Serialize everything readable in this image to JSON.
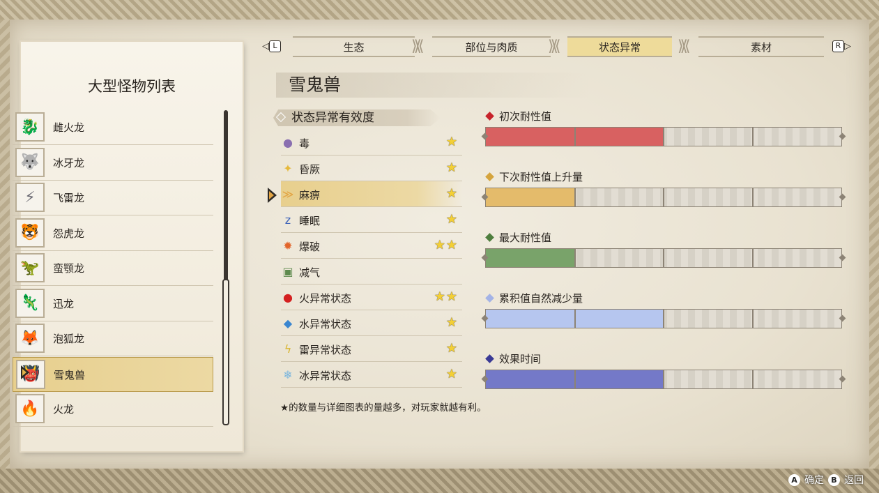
{
  "tabs": {
    "left_key": "L",
    "right_key": "R",
    "items": [
      {
        "label": "生态",
        "active": false
      },
      {
        "label": "部位与肉质",
        "active": false
      },
      {
        "label": "状态异常",
        "active": true
      },
      {
        "label": "素材",
        "active": false
      }
    ]
  },
  "left_panel": {
    "title": "大型怪物列表",
    "monsters": [
      {
        "name": "雌火龙",
        "selected": false
      },
      {
        "name": "冰牙龙",
        "selected": false
      },
      {
        "name": "飞雷龙",
        "selected": false
      },
      {
        "name": "怨虎龙",
        "selected": false
      },
      {
        "name": "蛮颚龙",
        "selected": false
      },
      {
        "name": "迅龙",
        "selected": false
      },
      {
        "name": "泡狐龙",
        "selected": false
      },
      {
        "name": "雪鬼兽",
        "selected": true
      },
      {
        "name": "火龙",
        "selected": false
      }
    ]
  },
  "monster": {
    "name": "雪鬼兽"
  },
  "status_table": {
    "header": "状态异常有效度",
    "rows": [
      {
        "icon": "poison-icon",
        "name": "毒",
        "stars": "★"
      },
      {
        "icon": "stun-icon",
        "name": "昏厥",
        "stars": "★"
      },
      {
        "icon": "paralysis-icon",
        "name": "麻痹",
        "stars": "★",
        "selected": true
      },
      {
        "icon": "sleep-icon",
        "name": "睡眠",
        "stars": "★"
      },
      {
        "icon": "blast-icon",
        "name": "爆破",
        "stars": "★★"
      },
      {
        "icon": "exhaust-icon",
        "name": "减气",
        "stars": ""
      },
      {
        "icon": "fireblight-icon",
        "name": "火异常状态",
        "stars": "★★"
      },
      {
        "icon": "waterblight-icon",
        "name": "水异常状态",
        "stars": "★"
      },
      {
        "icon": "thunderblight-icon",
        "name": "雷异常状态",
        "stars": "★"
      },
      {
        "icon": "iceblight-icon",
        "name": "冰异常状态",
        "stars": "★"
      }
    ],
    "footnote": "★的数量与详细图表的量越多，对玩家就越有利。"
  },
  "bars": [
    {
      "label": "初次耐性值",
      "color": "#d86161",
      "marker": "#c7232b",
      "fill": 0.5
    },
    {
      "label": "下次耐性值上升量",
      "color": "#e4bb6b",
      "marker": "#d5a43d",
      "fill": 0.25
    },
    {
      "label": "最大耐性值",
      "color": "#79a36a",
      "marker": "#4e7e3e",
      "fill": 0.25
    },
    {
      "label": "累积值自然减少量",
      "color": "#b6c6ef",
      "marker": "#a4b3e6",
      "fill": 0.5
    },
    {
      "label": "效果时间",
      "color": "#7479c8",
      "marker": "#3a3a95",
      "fill": 0.5
    }
  ],
  "buttons": {
    "confirm_key": "A",
    "confirm_label": "确定",
    "back_key": "B",
    "back_label": "返回"
  }
}
